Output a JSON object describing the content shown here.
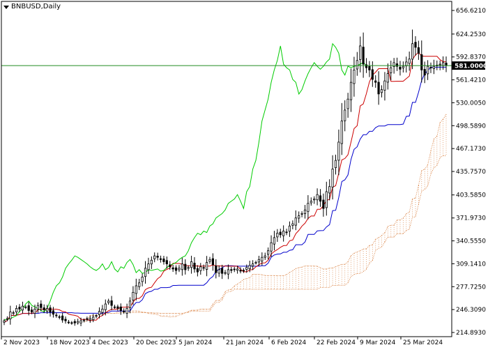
{
  "chart_data": {
    "type": "candlestick",
    "title": "BNBUSD,Daily",
    "ylim": [
      214.893,
      672.0
    ],
    "y_ticks": [
      "656.6210",
      "624.2530",
      "592.8370",
      "561.4210",
      "530.0050",
      "498.5890",
      "467.1730",
      "435.7570",
      "403.5850",
      "371.9730",
      "340.5550",
      "309.1410",
      "277.7250",
      "246.3090",
      "214.8930"
    ],
    "x_ticks": [
      "2 Nov 2023",
      "18 Nov 2023",
      "4 Dec 2023",
      "20 Dec 2023",
      "5 Jan 2024",
      "21 Jan 2024",
      "6 Feb 2024",
      "22 Feb 2024",
      "9 Mar 2024",
      "25 Mar 2024"
    ],
    "current_price": 581.0,
    "current_price_label": "581.0000",
    "colors": {
      "tenkan": "#cc0000",
      "kijun": "#0000cc",
      "chikou": "#00cc00",
      "cloud": "#d2691e",
      "candle": "#000000",
      "price_line": "#228b22"
    },
    "closes": [
      231,
      234,
      243,
      242,
      248,
      247,
      251,
      250,
      245,
      243,
      247,
      252,
      249,
      246,
      248,
      243,
      240,
      238,
      236,
      232,
      231,
      229,
      228,
      228,
      230,
      231,
      232,
      233,
      234,
      236,
      238,
      244,
      247,
      254,
      258,
      252,
      250,
      248,
      245,
      243,
      248,
      258,
      270,
      279,
      283,
      291,
      303,
      309,
      314,
      320,
      318,
      315,
      312,
      309,
      305,
      302,
      300,
      303,
      309,
      301,
      304,
      312,
      302,
      298,
      305,
      303,
      311,
      315,
      308,
      297,
      301,
      296,
      297,
      301,
      300,
      301,
      302,
      299,
      300,
      304,
      307,
      309,
      311,
      315,
      318,
      320,
      327,
      338,
      345,
      351,
      349,
      354,
      352,
      361,
      364,
      372,
      375,
      378,
      383,
      392,
      395,
      398,
      404,
      395,
      385,
      408,
      415,
      439,
      451,
      476,
      505,
      520,
      535,
      558,
      575,
      588,
      608,
      583,
      578,
      575,
      562,
      558,
      542,
      548,
      560,
      570,
      578,
      585,
      580,
      576,
      580,
      586,
      590,
      611,
      606,
      598,
      575,
      568,
      580,
      578,
      580,
      581,
      583,
      585,
      581
    ]
  }
}
